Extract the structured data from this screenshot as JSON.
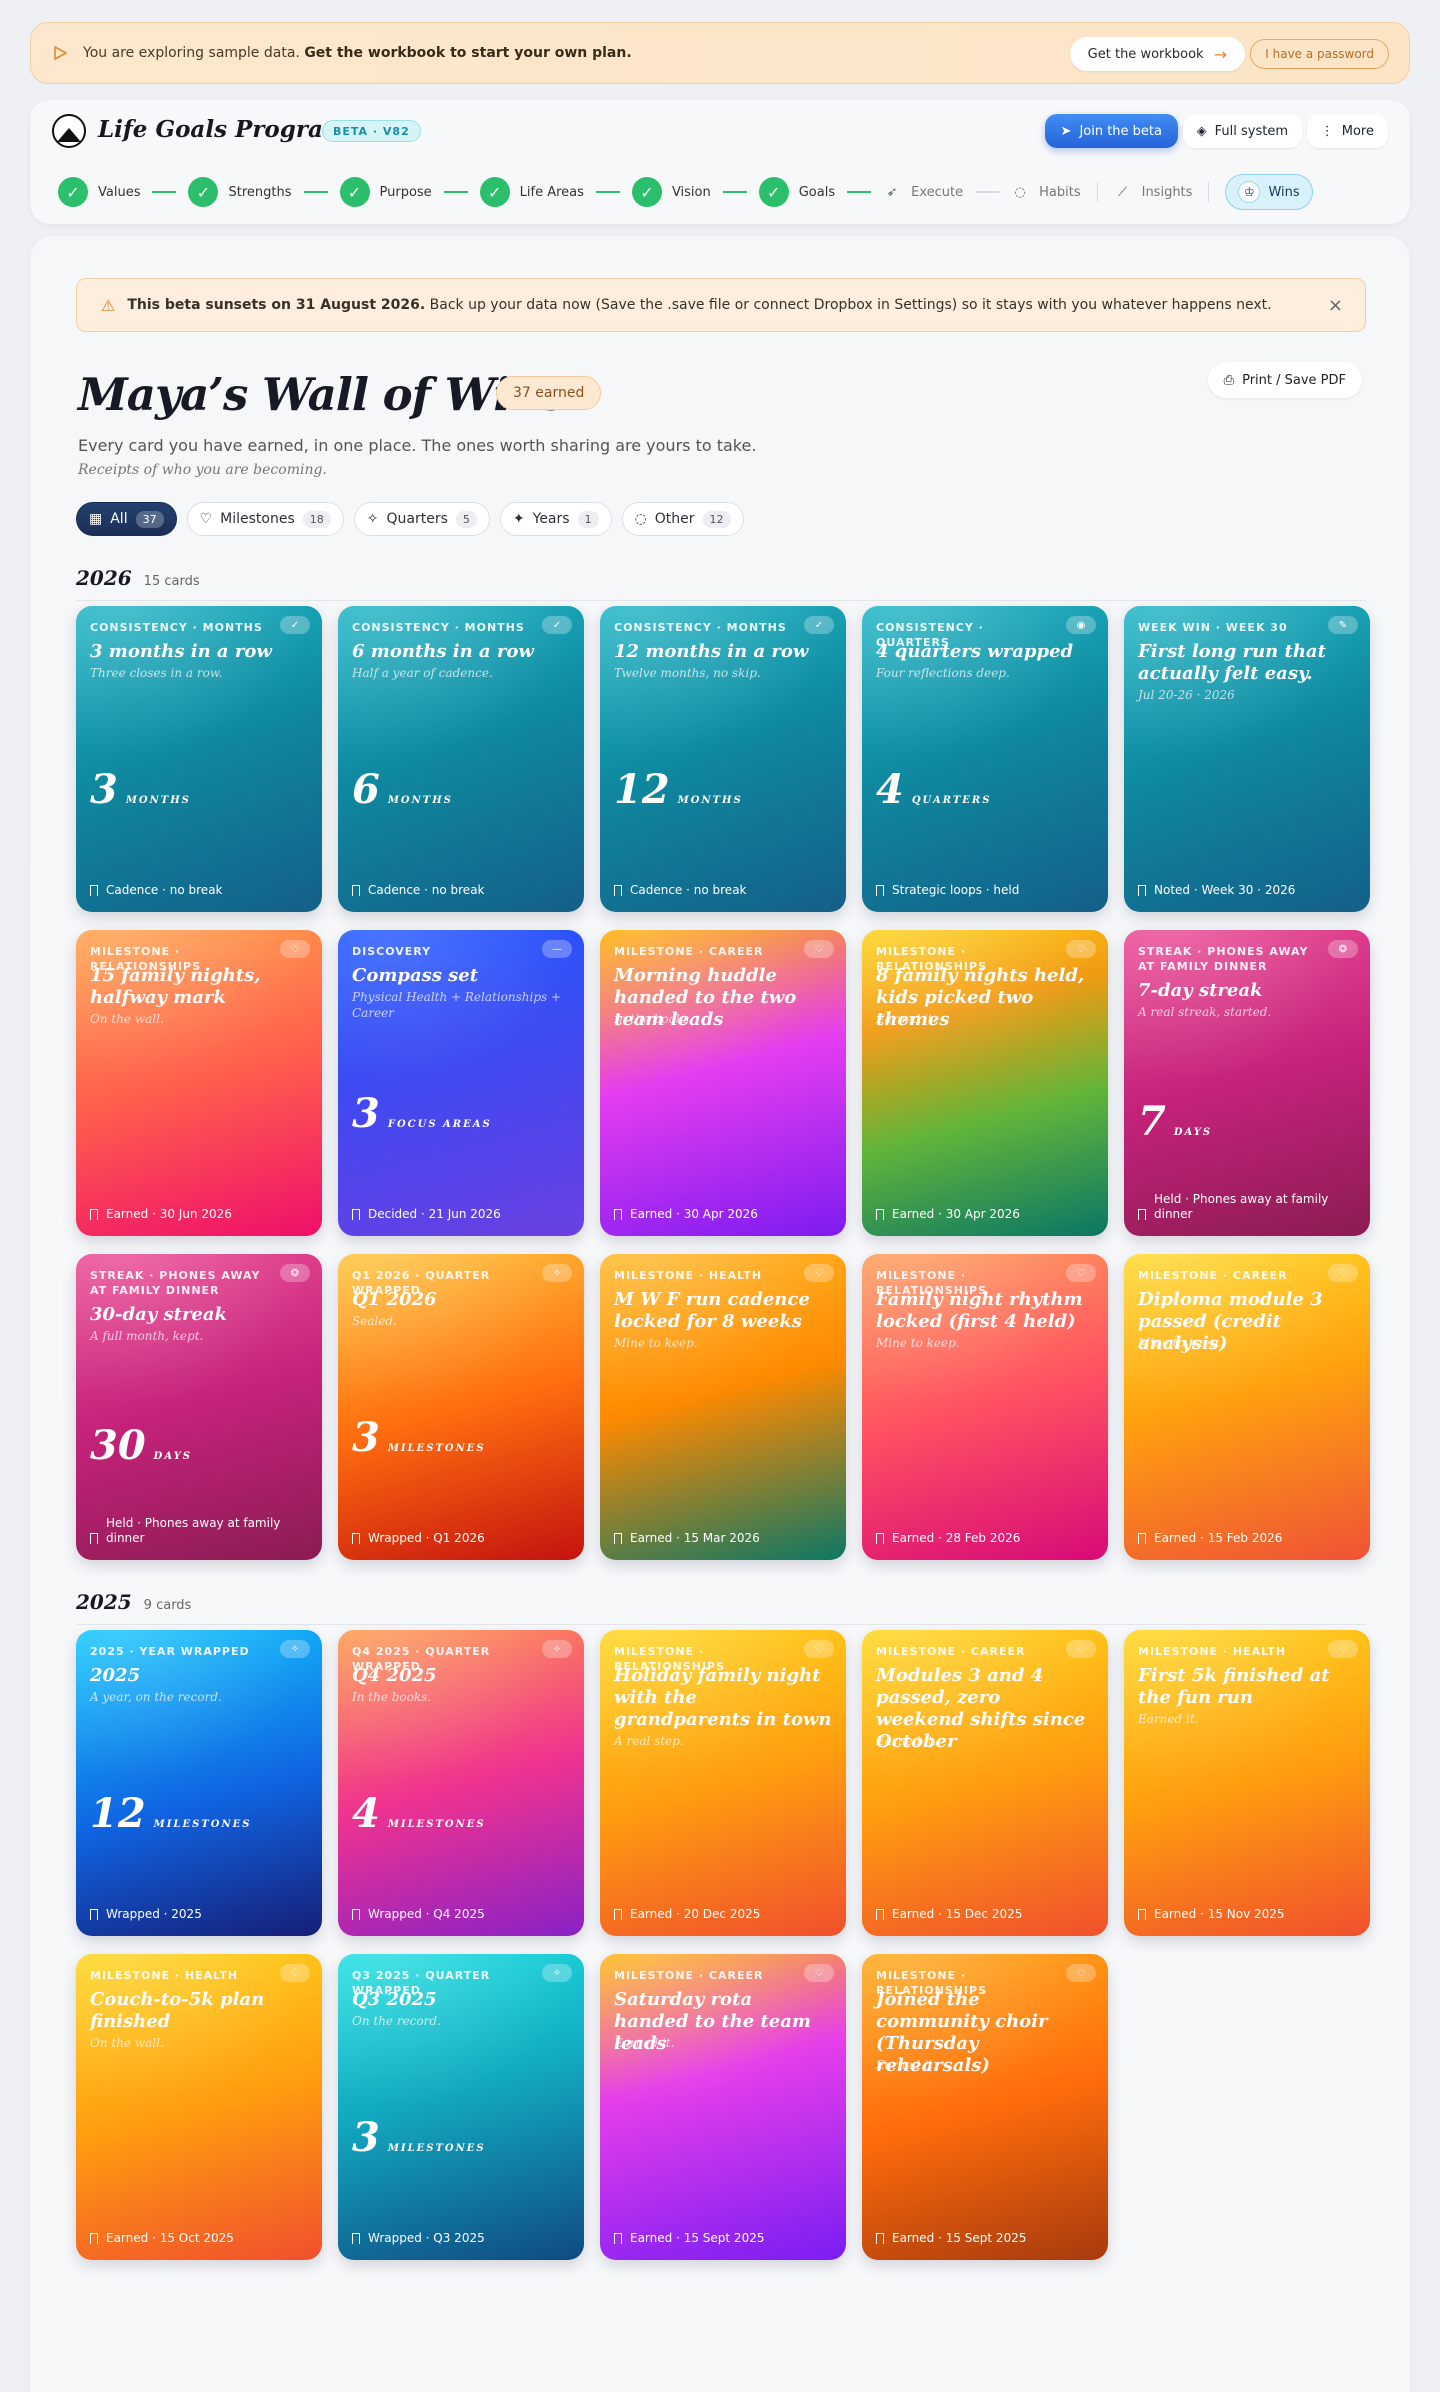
{
  "banner": {
    "text": "You are exploring sample data.",
    "bold": "Get the workbook to start your own plan.",
    "workbook": "Get the workbook",
    "password": "I have a password"
  },
  "header": {
    "brand": "Life Goals Program",
    "beta": "BETA · V82",
    "join": "Join the beta",
    "full": "Full system",
    "more": "More"
  },
  "steps": [
    {
      "label": "Values"
    },
    {
      "label": "Strengths"
    },
    {
      "label": "Purpose"
    },
    {
      "label": "Life Areas"
    },
    {
      "label": "Vision"
    },
    {
      "label": "Goals"
    },
    {
      "label": "Execute"
    },
    {
      "label": "Habits"
    },
    {
      "label": "Insights"
    },
    {
      "label": "Wins"
    }
  ],
  "warning": {
    "bold": "This beta sunsets on 31 August 2026.",
    "text": "Back up your data now (Save the .save file or connect Dropbox in Settings) so it stays with you whatever happens next."
  },
  "page": {
    "title": "Maya’s Wall of Wins",
    "earned": "37 earned",
    "print": "Print / Save PDF",
    "subtitle": "Every card you have earned, in one place. The ones worth sharing are yours to take.",
    "tagline": "Receipts of who you are becoming."
  },
  "filters": [
    {
      "label": "All",
      "count": "37"
    },
    {
      "label": "Milestones",
      "count": "18"
    },
    {
      "label": "Quarters",
      "count": "5"
    },
    {
      "label": "Years",
      "count": "1"
    },
    {
      "label": "Other",
      "count": "12"
    }
  ],
  "groups": [
    {
      "year": "2026",
      "count": "15 cards",
      "cards": [
        {
          "kicker": "CONSISTENCY · MONTHS",
          "title": "3 months in a row",
          "desc": "Three closes in a row.",
          "num": "3",
          "unit": "MONTHS",
          "foot": "Cadence · no break",
          "grad": "teal",
          "badge": "✓"
        },
        {
          "kicker": "CONSISTENCY · MONTHS",
          "title": "6 months in a row",
          "desc": "Half a year of cadence.",
          "num": "6",
          "unit": "MONTHS",
          "foot": "Cadence · no break",
          "grad": "teal",
          "badge": "✓"
        },
        {
          "kicker": "CONSISTENCY · MONTHS",
          "title": "12 months in a row",
          "desc": "Twelve months, no skip.",
          "num": "12",
          "unit": "MONTHS",
          "foot": "Cadence · no break",
          "grad": "teal",
          "badge": "✓"
        },
        {
          "kicker": "CONSISTENCY · QUARTERS",
          "title": "4 quarters wrapped",
          "desc": "Four reflections deep.",
          "num": "4",
          "unit": "QUARTERS",
          "foot": "Strategic loops · held",
          "grad": "teal",
          "badge": "◉"
        },
        {
          "kicker": "WEEK WIN · WEEK 30",
          "title": "First long run that actually felt easy.",
          "desc": "Jul 20-26 · 2026",
          "num": "",
          "unit": "",
          "foot": "Noted · Week 30 · 2026",
          "grad": "teal",
          "badge": "✎"
        },
        {
          "kicker": "MILESTONE · RELATIONSHIPS",
          "title": "15 family nights, halfway mark",
          "desc": "On the wall.",
          "num": "",
          "unit": "",
          "foot": "Earned · 30 Jun 2026",
          "grad": "orp",
          "badge": "♡"
        },
        {
          "kicker": "DISCOVERY",
          "title": "Compass set",
          "desc": "Physical Health + Relationships + Career",
          "num": "3",
          "unit": "FOCUS AREAS",
          "foot": "Decided · 21 Jun 2026",
          "grad": "blue",
          "badge": "—"
        },
        {
          "kicker": "MILESTONE · CAREER",
          "title": "Morning huddle handed to the two team leads",
          "desc": "In the books.",
          "num": "",
          "unit": "",
          "foot": "Earned · 30 Apr 2026",
          "grad": "mag",
          "badge": "♡"
        },
        {
          "kicker": "MILESTONE · RELATIONSHIPS",
          "title": "8 family nights held, kids picked two themes",
          "desc": "Earned it.",
          "num": "",
          "unit": "",
          "foot": "Earned · 30 Apr 2026",
          "grad": "ygr",
          "badge": "♡"
        },
        {
          "kicker": "STREAK · PHONES AWAY AT FAMILY DINNER",
          "title": "7-day streak",
          "desc": "A real streak, started.",
          "num": "7",
          "unit": "DAYS",
          "foot": "Held · Phones away at family dinner",
          "grad": "pink",
          "badge": "❂"
        },
        {
          "kicker": "STREAK · PHONES AWAY AT FAMILY DINNER",
          "title": "30-day streak",
          "desc": "A full month, kept.",
          "num": "30",
          "unit": "DAYS",
          "foot": "Held · Phones away at family dinner",
          "grad": "pink",
          "badge": "❂"
        },
        {
          "kicker": "Q1 2026 · QUARTER WRAPPED",
          "title": "Q1 2026",
          "desc": "Sealed.",
          "num": "3",
          "unit": "MILESTONES",
          "foot": "Wrapped · Q1 2026",
          "grad": "or",
          "badge": "✧"
        },
        {
          "kicker": "MILESTONE · HEALTH",
          "title": "M W F run cadence locked for 8 weeks",
          "desc": "Mine to keep.",
          "num": "",
          "unit": "",
          "foot": "Earned · 15 Mar 2026",
          "grad": "or2",
          "badge": "♡"
        },
        {
          "kicker": "MILESTONE · RELATIONSHIPS",
          "title": "Family night rhythm locked (first 4 held)",
          "desc": "Mine to keep.",
          "num": "",
          "unit": "",
          "foot": "Earned · 28 Feb 2026",
          "grad": "red",
          "badge": "♡"
        },
        {
          "kicker": "MILESTONE · CAREER",
          "title": "Diploma module 3 passed (credit analysis)",
          "desc": "Mine to keep.",
          "num": "",
          "unit": "",
          "foot": "Earned · 15 Feb 2026",
          "grad": "yo",
          "badge": "♡"
        }
      ]
    },
    {
      "year": "2025",
      "count": "9 cards",
      "cards": [
        {
          "kicker": "2025 · YEAR WRAPPED",
          "title": "2025",
          "desc": "A year, on the record.",
          "num": "12",
          "unit": "MILESTONES",
          "foot": "Wrapped · 2025",
          "grad": "sky",
          "badge": "✧"
        },
        {
          "kicker": "Q4 2025 · QUARTER WRAPPED",
          "title": "Q4 2025",
          "desc": "In the books.",
          "num": "4",
          "unit": "MILESTONES",
          "foot": "Wrapped · Q4 2025",
          "grad": "pp",
          "badge": "✧"
        },
        {
          "kicker": "MILESTONE · RELATIONSHIPS",
          "title": "Holiday family night with the grandparents in town",
          "desc": "A real step.",
          "num": "",
          "unit": "",
          "foot": "Earned · 20 Dec 2025",
          "grad": "ye",
          "badge": "♡"
        },
        {
          "kicker": "MILESTONE · CAREER",
          "title": "Modules 3 and 4 passed, zero weekend shifts since October",
          "desc": "Earned it.",
          "num": "",
          "unit": "",
          "foot": "Earned · 15 Dec 2025",
          "grad": "ye",
          "badge": "♡"
        },
        {
          "kicker": "MILESTONE · HEALTH",
          "title": "First 5k finished at the fun run",
          "desc": "Earned it.",
          "num": "",
          "unit": "",
          "foot": "Earned · 15 Nov 2025",
          "grad": "ye",
          "badge": "♡"
        },
        {
          "kicker": "MILESTONE · HEALTH",
          "title": "Couch-to-5k plan finished",
          "desc": "On the wall.",
          "num": "",
          "unit": "",
          "foot": "Earned · 15 Oct 2025",
          "grad": "ye",
          "badge": "♡"
        },
        {
          "kicker": "Q3 2025 · QUARTER WRAPPED",
          "title": "Q3 2025",
          "desc": "On the record.",
          "num": "3",
          "unit": "MILESTONES",
          "foot": "Wrapped · Q3 2025",
          "grad": "cy",
          "badge": "✧"
        },
        {
          "kicker": "MILESTONE · CAREER",
          "title": "Saturday rota handed to the team leads",
          "desc": "Earned it.",
          "num": "",
          "unit": "",
          "foot": "Earned · 15 Sept 2025",
          "grad": "mg2",
          "badge": "♡"
        },
        {
          "kicker": "MILESTONE · RELATIONSHIPS",
          "title": "Joined the community choir (Thursday rehearsals)",
          "desc": "Earned it.",
          "num": "",
          "unit": "",
          "foot": "Earned · 15 Sept 2025",
          "grad": "ob",
          "badge": "♡"
        }
      ]
    }
  ]
}
